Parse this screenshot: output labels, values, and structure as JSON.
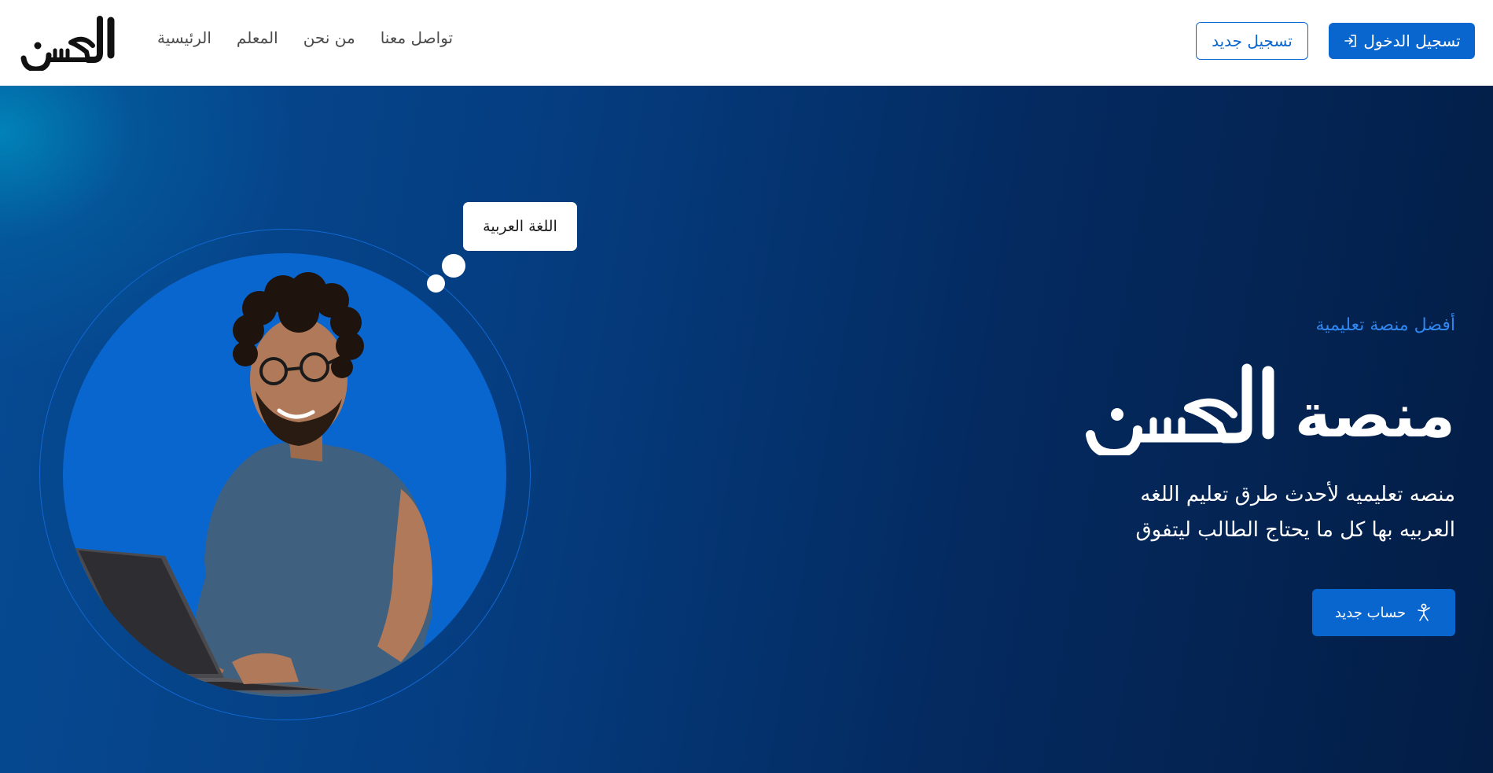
{
  "brand": {
    "logo_text": "الحسن",
    "logo_color": "#111111"
  },
  "nav": {
    "links": [
      {
        "label": "الرئيسية"
      },
      {
        "label": "المعلم"
      },
      {
        "label": "من نحن"
      },
      {
        "label": "تواصل معنا"
      }
    ],
    "login_label": "تسجيل الدخول",
    "login_icon": "sign-in-icon",
    "register_label": "تسجيل جديد"
  },
  "hero": {
    "speech_bubble": "اللغة العربية",
    "tagline": "أفضل منصة تعليمية",
    "title_prefix": "منصة",
    "title_logo": "الحسن",
    "description_line_1": "منصه تعليميه لأحدث طرق تعليم اللغه",
    "description_line_2": "العربيه بها كل ما يحتاج الطالب ليتفوق",
    "cta_label": "حساب جديد",
    "cta_icon": "person-icon"
  },
  "colors": {
    "primary": "#0a66cf",
    "tagline": "#2f86ee",
    "hero_dark": "#031d45",
    "hero_mid": "#064b94"
  }
}
